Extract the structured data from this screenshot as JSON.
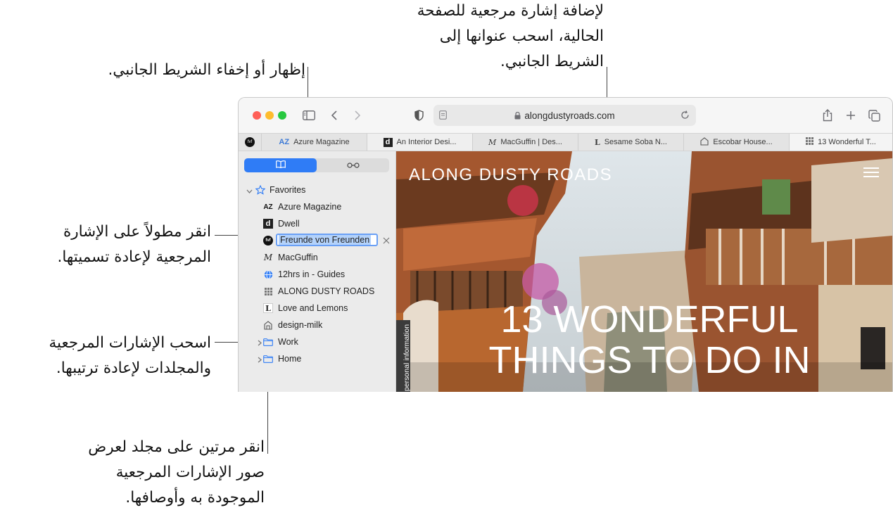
{
  "callouts": {
    "sidebar_toggle": [
      "إظهار أو إخفاء الشريط الجانبي."
    ],
    "add_bookmark": [
      "لإضافة إشارة مرجعية للصفحة",
      "الحالية، اسحب عنوانها إلى",
      "الشريط الجانبي."
    ],
    "rename": [
      "انقر مطولاً على الإشارة",
      "المرجعية لإعادة تسميتها."
    ],
    "reorder": [
      "اسحب الإشارات المرجعية",
      "والمجلدات لإعادة ترتيبها."
    ],
    "folder_view": [
      "انقر مرتين على مجلد لعرض",
      "صور الإشارات المرجعية",
      "الموجودة به وأوصافها."
    ]
  },
  "colors": {
    "close": "#ff5f57",
    "minimize": "#febc2e",
    "zoom": "#28c840",
    "accent": "#2f7cf6",
    "edit_highlight": "#b3d2fb"
  },
  "toolbar": {
    "url": "alongdustyroads.com",
    "icons": [
      "sidebar-icon",
      "back-icon",
      "forward-icon",
      "shield-icon",
      "page-icon",
      "lock-icon",
      "reload-icon",
      "share-icon",
      "new-tab-icon",
      "tabs-overview-icon"
    ]
  },
  "tabs": [
    {
      "favicon": "fvf",
      "label": ""
    },
    {
      "favicon": "AZ",
      "label": "Azure Magazine"
    },
    {
      "favicon": "d",
      "label": "An Interior Desi..."
    },
    {
      "favicon": "M",
      "label": "MacGuffin | Des..."
    },
    {
      "favicon": "L",
      "label": "Sesame Soba N..."
    },
    {
      "favicon": "house",
      "label": "Escobar House..."
    },
    {
      "favicon": "grid",
      "label": "13 Wonderful T..."
    }
  ],
  "sidebar": {
    "segments": [
      "bookmarks-icon",
      "reading-list-icon"
    ],
    "favorites_label": "Favorites",
    "items": [
      {
        "favicon": "AZ",
        "label": "Azure Magazine"
      },
      {
        "favicon": "d",
        "label": "Dwell"
      },
      {
        "favicon": "fvf",
        "label": "Freunde von Freunden"
      },
      {
        "favicon": "M",
        "label": "MacGuffin"
      },
      {
        "favicon": "globe",
        "label": "12hrs in - Guides"
      },
      {
        "favicon": "grid",
        "label": "ALONG DUSTY ROADS"
      },
      {
        "favicon": "L",
        "label": "Love and Lemons"
      },
      {
        "favicon": "house",
        "label": "design-milk"
      }
    ],
    "folders": [
      {
        "label": "Work"
      },
      {
        "label": "Home"
      }
    ]
  },
  "content": {
    "site_title": "ALONG DUSTY ROADS",
    "headline": [
      "13 WONDERFUL",
      "THINGS TO DO IN"
    ],
    "side_tab": "personal information"
  }
}
